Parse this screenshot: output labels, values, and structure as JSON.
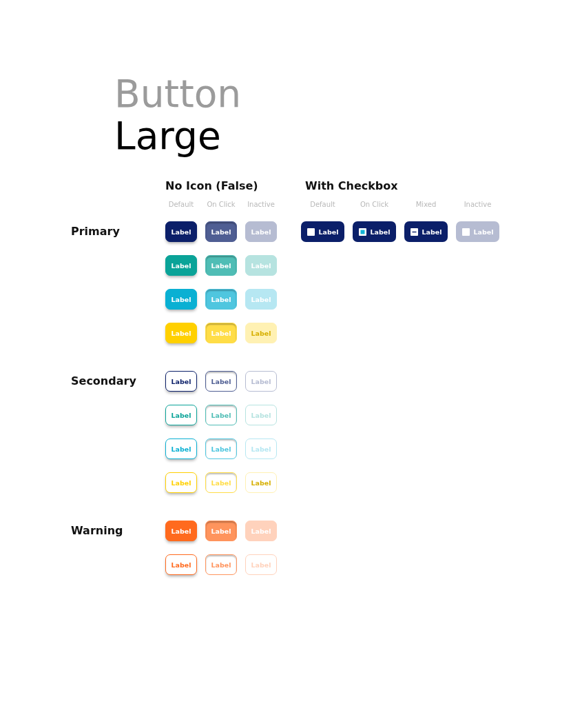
{
  "title": "Button",
  "subtitle": "Large",
  "column_groups": [
    {
      "heading": "No Icon (False)",
      "states": [
        "Default",
        "On Click",
        "Inactive"
      ]
    },
    {
      "heading": "With Checkbox",
      "states": [
        "Default",
        "On Click",
        "Mixed",
        "Inactive"
      ]
    }
  ],
  "sections": [
    {
      "name": "Primary",
      "rows": [
        {
          "kind": "filled",
          "color": "#0b1f69",
          "buttons": [
            {
              "label": "Label",
              "pressed": false,
              "disabled": false
            },
            {
              "label": "Label",
              "pressed": true,
              "disabled": false
            },
            {
              "label": "Label",
              "pressed": false,
              "disabled": true
            }
          ],
          "checkbox_buttons": [
            {
              "label": "Label",
              "checked": false,
              "mixed": false,
              "disabled": false
            },
            {
              "label": "Label",
              "checked": true,
              "mixed": false,
              "disabled": false
            },
            {
              "label": "Label",
              "checked": false,
              "mixed": true,
              "disabled": false
            },
            {
              "label": "Label",
              "checked": false,
              "mixed": false,
              "disabled": true
            }
          ]
        },
        {
          "kind": "filled",
          "color": "#0aa398",
          "buttons": [
            {
              "label": "Label",
              "pressed": false,
              "disabled": false
            },
            {
              "label": "Label",
              "pressed": true,
              "disabled": false
            },
            {
              "label": "Label",
              "pressed": false,
              "disabled": true
            }
          ]
        },
        {
          "kind": "filled",
          "color": "#0ab0d3",
          "buttons": [
            {
              "label": "Label",
              "pressed": false,
              "disabled": false
            },
            {
              "label": "Label",
              "pressed": true,
              "disabled": false
            },
            {
              "label": "Label",
              "pressed": false,
              "disabled": true
            }
          ]
        },
        {
          "kind": "filled",
          "color": "#ffd000",
          "buttons": [
            {
              "label": "Label",
              "pressed": false,
              "disabled": false
            },
            {
              "label": "Label",
              "pressed": true,
              "disabled": false
            },
            {
              "label": "Label",
              "pressed": false,
              "disabled": true
            }
          ]
        }
      ]
    },
    {
      "name": "Secondary",
      "rows": [
        {
          "kind": "outline",
          "color": "#0b1f69",
          "buttons": [
            {
              "label": "Label",
              "pressed": false,
              "disabled": false
            },
            {
              "label": "Label",
              "pressed": true,
              "disabled": false
            },
            {
              "label": "Label",
              "pressed": false,
              "disabled": true
            }
          ]
        },
        {
          "kind": "outline",
          "color": "#0aa398",
          "buttons": [
            {
              "label": "Label",
              "pressed": false,
              "disabled": false
            },
            {
              "label": "Label",
              "pressed": true,
              "disabled": false
            },
            {
              "label": "Label",
              "pressed": false,
              "disabled": true
            }
          ]
        },
        {
          "kind": "outline",
          "color": "#0ab0d3",
          "buttons": [
            {
              "label": "Label",
              "pressed": false,
              "disabled": false
            },
            {
              "label": "Label",
              "pressed": true,
              "disabled": false
            },
            {
              "label": "Label",
              "pressed": false,
              "disabled": true
            }
          ]
        },
        {
          "kind": "outline",
          "color": "#ffd000",
          "buttons": [
            {
              "label": "Label",
              "pressed": false,
              "disabled": false
            },
            {
              "label": "Label",
              "pressed": true,
              "disabled": false
            },
            {
              "label": "Label",
              "pressed": false,
              "disabled": true
            }
          ]
        }
      ]
    },
    {
      "name": "Warning",
      "rows": [
        {
          "kind": "filled",
          "color": "#ff6a1e",
          "buttons": [
            {
              "label": "Label",
              "pressed": false,
              "disabled": false
            },
            {
              "label": "Label",
              "pressed": true,
              "disabled": false
            },
            {
              "label": "Label",
              "pressed": false,
              "disabled": true
            }
          ]
        },
        {
          "kind": "outline",
          "color": "#ff6a1e",
          "buttons": [
            {
              "label": "Label",
              "pressed": false,
              "disabled": false
            },
            {
              "label": "Label",
              "pressed": true,
              "disabled": false
            },
            {
              "label": "Label",
              "pressed": false,
              "disabled": true
            }
          ]
        }
      ]
    }
  ]
}
